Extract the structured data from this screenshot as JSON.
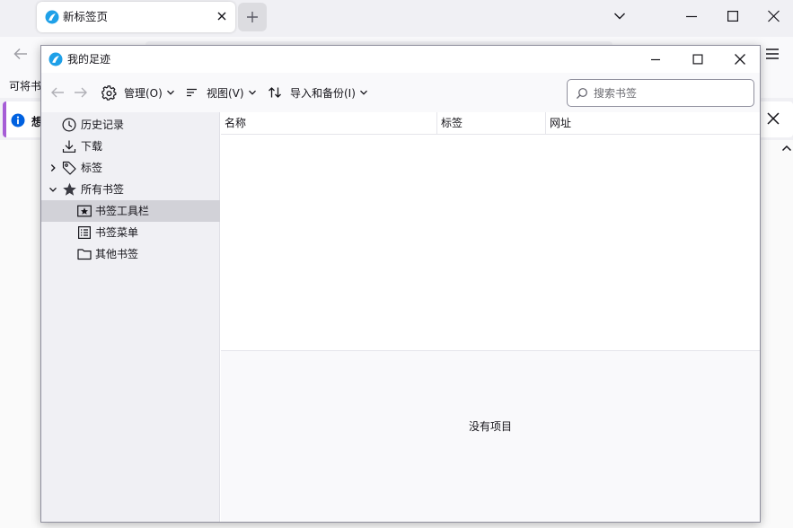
{
  "browser": {
    "tab_title": "新标签页",
    "bookmarks_bar_text": "可将书",
    "infobar_text": "想"
  },
  "library": {
    "title": "我的足迹",
    "toolbar": {
      "organize_label": "管理(O)",
      "views_label": "视图(V)",
      "import_label": "导入和备份(I)"
    },
    "search": {
      "placeholder": "搜索书签"
    },
    "sidebar": {
      "items": [
        {
          "label": "历史记录",
          "icon": "clock-icon"
        },
        {
          "label": "下载",
          "icon": "download-icon"
        },
        {
          "label": "标签",
          "icon": "tag-icon",
          "collapsed": true
        },
        {
          "label": "所有书签",
          "icon": "star-icon",
          "expanded": true
        },
        {
          "label": "书签工具栏",
          "icon": "bookmarks-toolbar-icon",
          "selected": true
        },
        {
          "label": "书签菜单",
          "icon": "bookmarks-menu-icon"
        },
        {
          "label": "其他书签",
          "icon": "folder-icon"
        }
      ]
    },
    "columns": [
      "名称",
      "标签",
      "网址"
    ],
    "empty_text": "没有项目"
  },
  "colors": {
    "accent": "#0061e0",
    "info_stripe": "#a65dd6",
    "selected_row": "#d2d2d8"
  }
}
